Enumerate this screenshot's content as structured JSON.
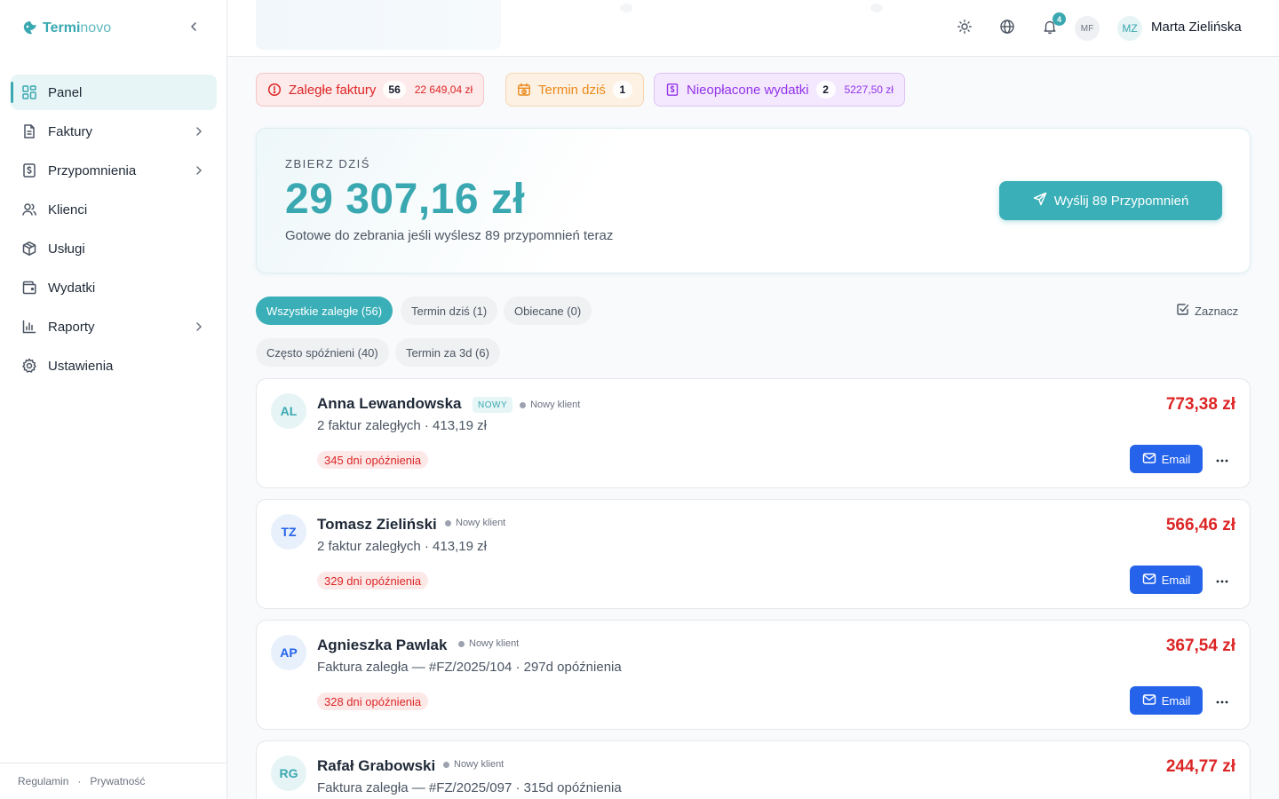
{
  "brand": {
    "part1": "Termi",
    "part2": "novo"
  },
  "nav": {
    "items": [
      {
        "label": "Panel",
        "icon": "dashboard-icon",
        "active": true
      },
      {
        "label": "Faktury",
        "icon": "document-icon",
        "chevron": true
      },
      {
        "label": "Przypomnienia",
        "icon": "dollar-bill-icon",
        "chevron": true
      },
      {
        "label": "Klienci",
        "icon": "users-icon"
      },
      {
        "label": "Usługi",
        "icon": "package-icon"
      },
      {
        "label": "Wydatki",
        "icon": "wallet-icon"
      },
      {
        "label": "Raporty",
        "icon": "bar-chart-icon",
        "chevron": true
      },
      {
        "label": "Ustawienia",
        "icon": "gear-icon"
      }
    ]
  },
  "footer": {
    "terms": "Regulamin",
    "separator": "·",
    "privacy": "Prywatność"
  },
  "header": {
    "notifications": "4",
    "avatar_secondary": "MF",
    "avatar_user": "MZ",
    "user_name": "Marta Zielińska"
  },
  "alerts": {
    "overdue": {
      "label": "Zaległe faktury",
      "count": "56",
      "amount": "22 649,04 zł"
    },
    "due_today": {
      "label": "Termin dziś",
      "count": "1"
    },
    "unpaid_expenses": {
      "label": "Nieopłacone wydatki",
      "count": "2",
      "amount": "5227,50 zł"
    }
  },
  "hero": {
    "kicker": "ZBIERZ DZIŚ",
    "amount": "29 307,16 zł",
    "subtitle": "Gotowe do zebrania jeśli wyślesz 89 przypomnień teraz",
    "button": "Wyślij 89 Przypomnień"
  },
  "filters": {
    "all": "Wszystkie zaległe (56)",
    "due_today": "Termin dziś (1)",
    "promised": "Obiecane (0)",
    "often_late": "Często spóźnieni (40)",
    "due_3d": "Termin za 3d (6)",
    "select": "Zaznacz"
  },
  "clients": [
    {
      "initials": "AL",
      "name": "Anna Lewandowska",
      "new_tag": "NOWY",
      "status": "Nowy klient",
      "detail": "2 faktur zaległych · 413,19 zł",
      "delay": "345 dni opóźnienia",
      "amount": "773,38 zł",
      "email": "Email"
    },
    {
      "initials": "TZ",
      "name": "Tomasz Zieliński",
      "status": "Nowy klient",
      "detail": "2 faktur zaległych · 413,19 zł",
      "delay": "329 dni opóźnienia",
      "amount": "566,46 zł",
      "email": "Email"
    },
    {
      "initials": "AP",
      "name": "Agnieszka Pawlak",
      "status": "Nowy klient",
      "detail": "Faktura zaległa — #FZ/2025/104 · 297d opóźnienia",
      "delay": "328 dni opóźnienia",
      "amount": "367,54 zł",
      "email": "Email"
    },
    {
      "initials": "RG",
      "name": "Rafał Grabowski",
      "status": "Nowy klient",
      "detail": "Faktura zaległa — #FZ/2025/097 · 315d opóźnienia",
      "amount": "244,77 zł"
    }
  ],
  "colors": {
    "brand_teal": "#3aa8b1",
    "danger_red": "#dc2626",
    "warning_orange": "#ea8a1a",
    "purple": "#9333ea",
    "email_blue": "#2563eb"
  }
}
